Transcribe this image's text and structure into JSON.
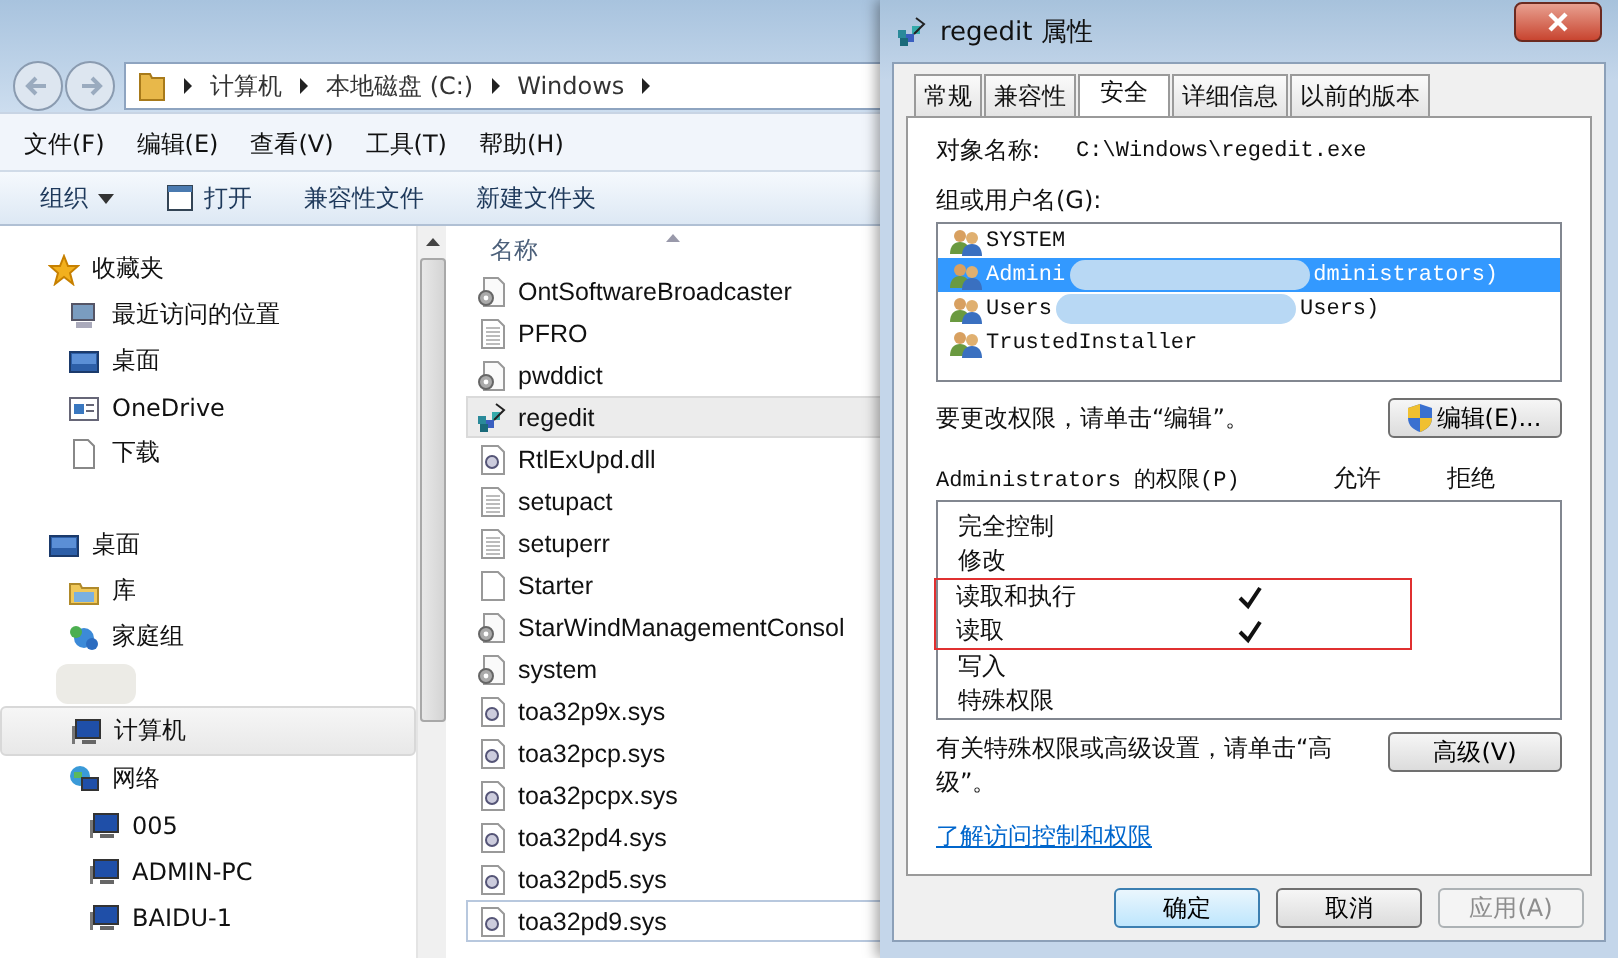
{
  "explorer": {
    "breadcrumb": [
      "计算机",
      "本地磁盘 (C:)",
      "Windows"
    ],
    "menu": [
      "文件(F)",
      "编辑(E)",
      "查看(V)",
      "工具(T)",
      "帮助(H)"
    ],
    "toolbar": [
      {
        "label": "组织",
        "kind": "dropdown"
      },
      {
        "label": "打开",
        "kind": "icon"
      },
      {
        "label": "兼容性文件",
        "kind": "plain"
      },
      {
        "label": "新建文件夹",
        "kind": "plain"
      }
    ],
    "nav": [
      {
        "label": "收藏夹",
        "kind": "star",
        "selected": false,
        "children": [
          {
            "label": "最近访问的位置",
            "kind": "recent",
            "selected": false
          },
          {
            "label": "桌面",
            "kind": "desktop",
            "selected": false
          },
          {
            "label": "OneDrive",
            "kind": "window",
            "selected": false
          },
          {
            "label": "下载",
            "kind": "doc",
            "selected": false
          }
        ]
      },
      {
        "label": "桌面",
        "kind": "desktop",
        "selected": false,
        "children": [
          {
            "label": "库",
            "kind": "library",
            "selected": false
          },
          {
            "label": "家庭组",
            "kind": "homegroup",
            "selected": false
          },
          {
            "kind": "redacted"
          },
          {
            "label": "计算机",
            "kind": "computer",
            "selected": true
          },
          {
            "label": "网络",
            "kind": "network",
            "selected": false,
            "children": [
              {
                "label": "005",
                "kind": "computer",
                "selected": false
              },
              {
                "label": "ADMIN-PC",
                "kind": "computer",
                "selected": false
              },
              {
                "label": "BAIDU-1",
                "kind": "computer",
                "selected": false
              }
            ]
          }
        ]
      }
    ],
    "file_header": "名称",
    "files": [
      {
        "name": "OntSoftwareBroadcaster",
        "kind": "config",
        "selected": false,
        "focused": false
      },
      {
        "name": "PFRO",
        "kind": "text",
        "selected": false,
        "focused": false
      },
      {
        "name": "pwddict",
        "kind": "config",
        "selected": false,
        "focused": false
      },
      {
        "name": "regedit",
        "kind": "regedit",
        "selected": true,
        "focused": false
      },
      {
        "name": "RtlExUpd.dll",
        "kind": "sys",
        "selected": false,
        "focused": false
      },
      {
        "name": "setupact",
        "kind": "text",
        "selected": false,
        "focused": false
      },
      {
        "name": "setuperr",
        "kind": "text",
        "selected": false,
        "focused": false
      },
      {
        "name": "Starter",
        "kind": "blank",
        "selected": false,
        "focused": false
      },
      {
        "name": "StarWindManagementConsol",
        "kind": "config",
        "selected": false,
        "focused": false
      },
      {
        "name": "system",
        "kind": "config",
        "selected": false,
        "focused": false
      },
      {
        "name": "toa32p9x.sys",
        "kind": "sys",
        "selected": false,
        "focused": false
      },
      {
        "name": "toa32pcp.sys",
        "kind": "sys",
        "selected": false,
        "focused": false
      },
      {
        "name": "toa32pcpx.sys",
        "kind": "sys",
        "selected": false,
        "focused": false
      },
      {
        "name": "toa32pd4.sys",
        "kind": "sys",
        "selected": false,
        "focused": false
      },
      {
        "name": "toa32pd5.sys",
        "kind": "sys",
        "selected": false,
        "focused": false
      },
      {
        "name": "toa32pd9.sys",
        "kind": "sys",
        "selected": false,
        "focused": true
      }
    ]
  },
  "dialog": {
    "title": "regedit 属性",
    "tabs": [
      {
        "label": "常规",
        "selected": false
      },
      {
        "label": "兼容性",
        "selected": false
      },
      {
        "label": "安全",
        "selected": true
      },
      {
        "label": "详细信息",
        "selected": false
      },
      {
        "label": "以前的版本",
        "selected": false
      }
    ],
    "object_label": "对象名称:",
    "object_value": "C:\\Windows\\regedit.exe",
    "group_label": "组或用户名(G):",
    "users": [
      {
        "name": "SYSTEM",
        "selected": false
      },
      {
        "name": "Admini",
        "tail": "dministrators)",
        "selected": true
      },
      {
        "name": "Users",
        "tail": "Users)",
        "selected": false
      },
      {
        "name": "TrustedInstaller",
        "selected": false
      }
    ],
    "edit_hint": "要更改权限，请单击“编辑”。",
    "edit_button": "编辑(E)...",
    "perm_label": "Administrators 的权限(P)",
    "allow_label": "允许",
    "deny_label": "拒绝",
    "permissions": [
      {
        "name": "完全控制",
        "allow": false,
        "deny": false,
        "highlighted": false
      },
      {
        "name": "修改",
        "allow": false,
        "deny": false,
        "highlighted": false
      },
      {
        "name": "读取和执行",
        "allow": true,
        "deny": false,
        "highlighted": true
      },
      {
        "name": "读取",
        "allow": true,
        "deny": false,
        "highlighted": true
      },
      {
        "name": "写入",
        "allow": false,
        "deny": false,
        "highlighted": false
      },
      {
        "name": "特殊权限",
        "allow": false,
        "deny": false,
        "highlighted": false
      }
    ],
    "advanced_text": "有关特殊权限或高级设置，请单击“高级”。",
    "advanced_button": "高级(V)",
    "link": "了解访问控制和权限",
    "buttons": [
      {
        "label": "确定",
        "kind": "default"
      },
      {
        "label": "取消",
        "kind": "normal"
      },
      {
        "label": "应用(A)",
        "kind": "disabled"
      }
    ]
  }
}
